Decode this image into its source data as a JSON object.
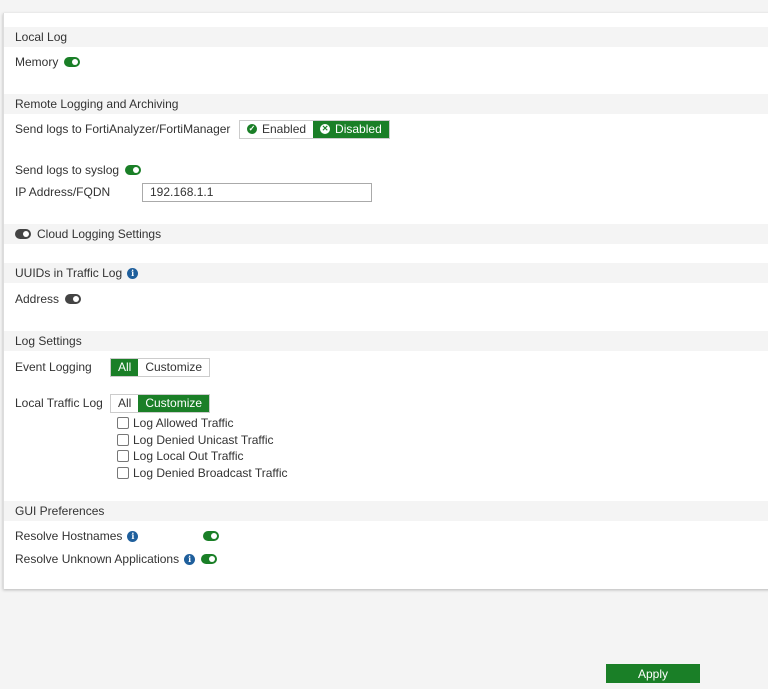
{
  "colors": {
    "accent": "#1a7f27",
    "info": "#1f5f9c",
    "section_bg": "#f4f4f4"
  },
  "local_log": {
    "title": "Local Log",
    "memory_label": "Memory",
    "memory_enabled": true
  },
  "remote": {
    "title": "Remote Logging and Archiving",
    "faz_label": "Send logs to FortiAnalyzer/FortiManager",
    "faz_options": [
      "Enabled",
      "Disabled"
    ],
    "faz_selected": "Disabled",
    "syslog_label": "Send logs to syslog",
    "syslog_enabled": true,
    "ip_label": "IP Address/FQDN",
    "ip_value": "192.168.1.1"
  },
  "cloud": {
    "title": "Cloud Logging Settings",
    "enabled": false
  },
  "uuids": {
    "title": "UUIDs in Traffic Log",
    "address_label": "Address",
    "address_enabled": false
  },
  "log_settings": {
    "title": "Log Settings",
    "event_label": "Event Logging",
    "event_options": [
      "All",
      "Customize"
    ],
    "event_selected": "All",
    "traffic_label": "Local Traffic Log",
    "traffic_options": [
      "All",
      "Customize"
    ],
    "traffic_selected": "Customize",
    "checkboxes": [
      {
        "label": "Log Allowed Traffic",
        "checked": false
      },
      {
        "label": "Log Denied Unicast Traffic",
        "checked": false
      },
      {
        "label": "Log Local Out Traffic",
        "checked": false
      },
      {
        "label": "Log Denied Broadcast Traffic",
        "checked": false
      }
    ]
  },
  "gui": {
    "title": "GUI Preferences",
    "hostnames_label": "Resolve Hostnames",
    "hostnames_enabled": true,
    "apps_label": "Resolve Unknown Applications",
    "apps_enabled": true
  },
  "apply_label": "Apply"
}
